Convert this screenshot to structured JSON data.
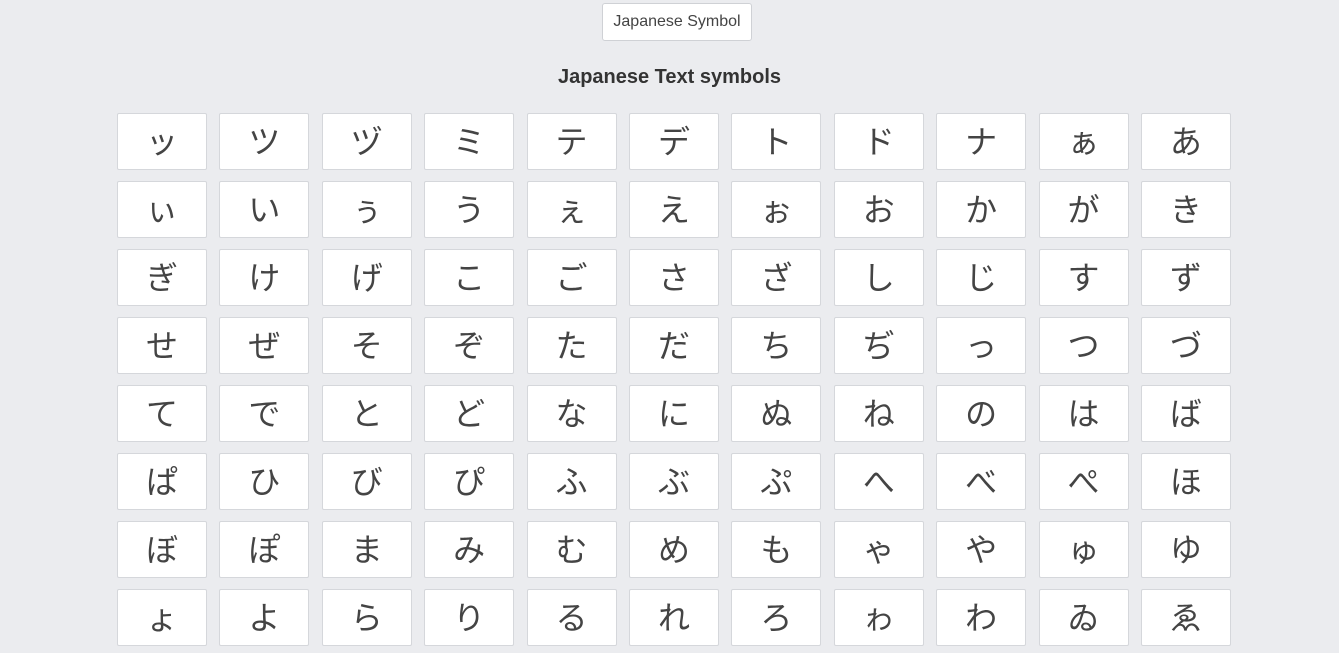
{
  "header": {
    "button_label": "Japanese Symbol",
    "title": "Japanese Text symbols"
  },
  "symbols": [
    "ッ",
    "ツ",
    "ヅ",
    "ミ",
    "テ",
    "デ",
    "ト",
    "ド",
    "ナ",
    "ぁ",
    "あ",
    "ぃ",
    "い",
    "ぅ",
    "う",
    "ぇ",
    "え",
    "ぉ",
    "お",
    "か",
    "が",
    "き",
    "ぎ",
    "け",
    "げ",
    "こ",
    "ご",
    "さ",
    "ざ",
    "し",
    "じ",
    "す",
    "ず",
    "せ",
    "ぜ",
    "そ",
    "ぞ",
    "た",
    "だ",
    "ち",
    "ぢ",
    "っ",
    "つ",
    "づ",
    "て",
    "で",
    "と",
    "ど",
    "な",
    "に",
    "ぬ",
    "ね",
    "の",
    "は",
    "ば",
    "ぱ",
    "ひ",
    "び",
    "ぴ",
    "ふ",
    "ぶ",
    "ぷ",
    "へ",
    "べ",
    "ぺ",
    "ほ",
    "ぼ",
    "ぽ",
    "ま",
    "み",
    "む",
    "め",
    "も",
    "ゃ",
    "や",
    "ゅ",
    "ゆ",
    "ょ",
    "よ",
    "ら",
    "り",
    "る",
    "れ",
    "ろ",
    "ゎ",
    "わ",
    "ゐ",
    "ゑ"
  ]
}
